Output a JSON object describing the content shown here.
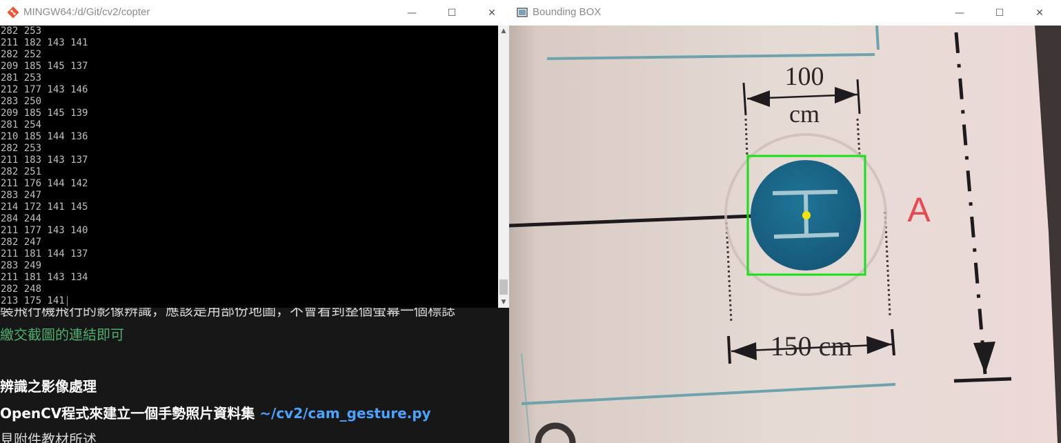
{
  "background_doc": {
    "cut_line": "裝飛行機飛行的影像辨識，應該是用部份地圖，不會看到整個螢幕一個標誌",
    "green_line": "繳交截圖的連結即可",
    "bold_line_1": "辨識之影像處理",
    "bold_line_2_prefix": "OpenCV程式來建立一個手勢照片資料集 ",
    "bold_line_2_code": "~/cv2/cam_gesture.py",
    "plain_line": "見附件教材所述"
  },
  "terminal": {
    "title": "MINGW64:/d/Git/cv2/copter",
    "lines": [
      "282 253",
      "211 182 143 141",
      "282 252",
      "209 185 145 137",
      "281 253",
      "212 177 143 146",
      "283 250",
      "209 185 145 139",
      "281 254",
      "210 185 144 136",
      "282 253",
      "211 183 143 137",
      "282 251",
      "211 176 144 142",
      "283 247",
      "214 172 141 145",
      "284 244",
      "211 177 143 140",
      "282 247",
      "211 181 144 137",
      "283 249",
      "211 181 143 134",
      "282 248",
      "213 175 141"
    ]
  },
  "bbox_window": {
    "title": "Bounding BOX",
    "diagram": {
      "top_dim_value": "100",
      "top_dim_unit": "cm",
      "bottom_dim": "150 cm",
      "marker_label": "A"
    }
  },
  "window_buttons": {
    "minimize": "—",
    "maximize": "☐",
    "close": "✕"
  },
  "colors": {
    "detection_box": "#16e016",
    "center_dot": "#f5e20a",
    "helipad": "#1c6a88"
  }
}
